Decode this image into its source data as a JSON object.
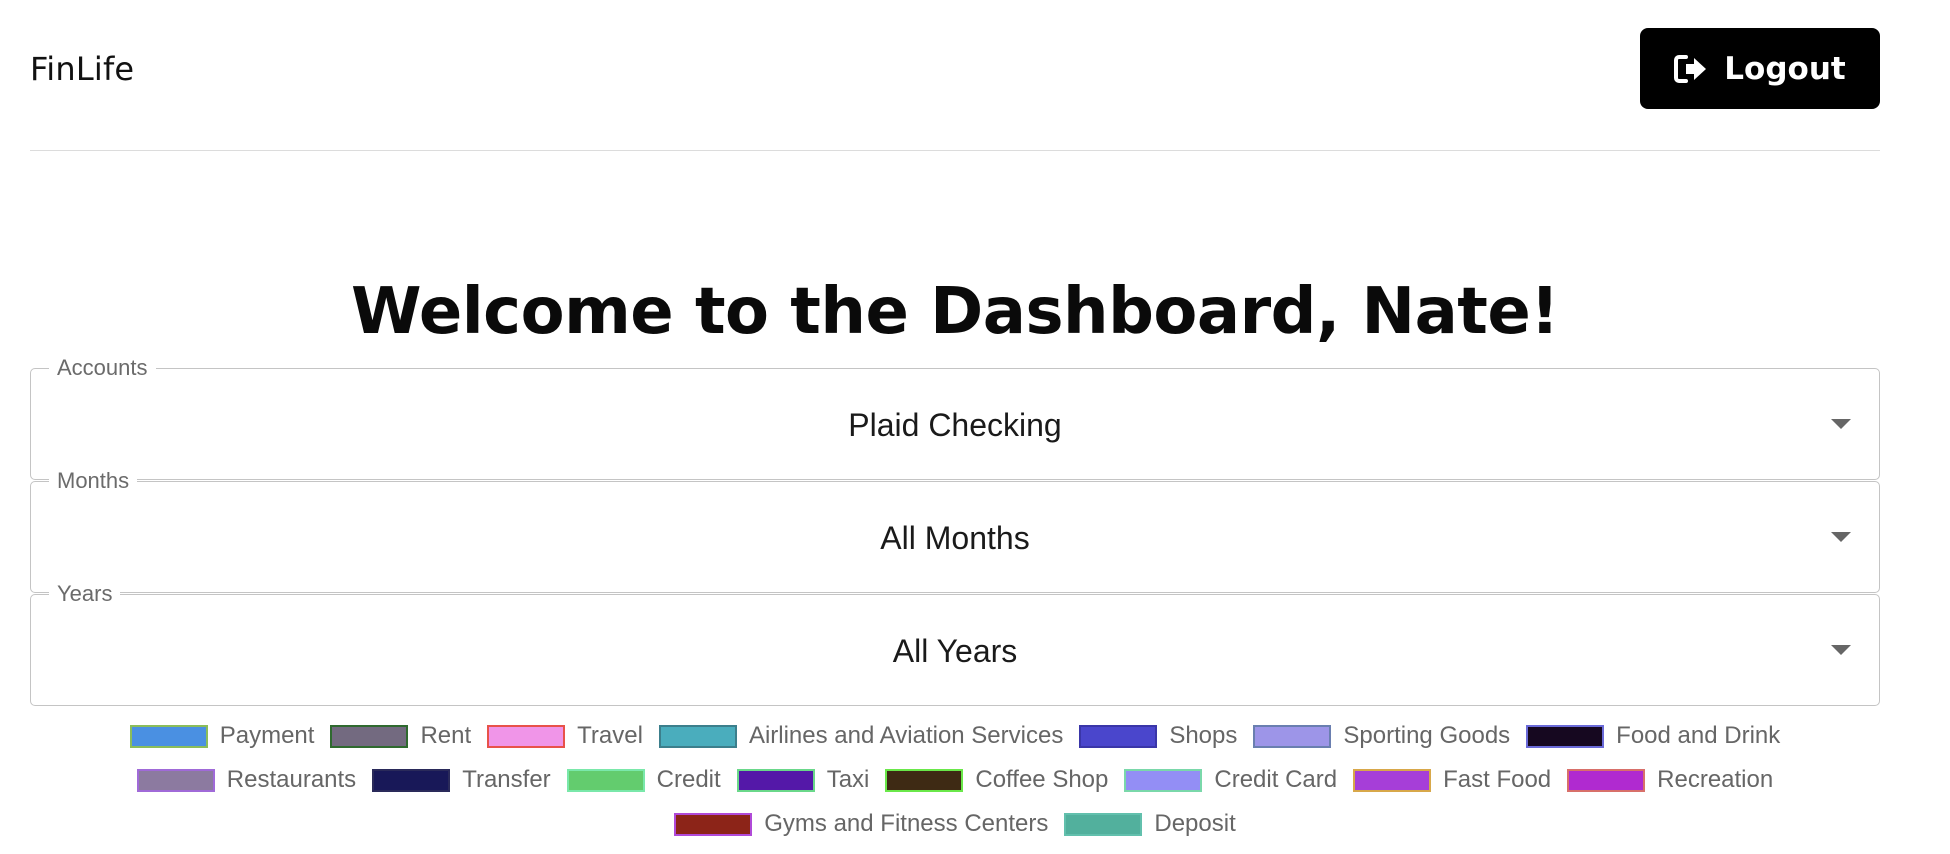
{
  "header": {
    "brand": "FinLife",
    "logout_label": "Logout",
    "logout_icon": "sign-out-icon"
  },
  "title": "Welcome to the Dashboard, Nate!",
  "filters": {
    "accounts": {
      "label": "Accounts",
      "value": "Plaid Checking"
    },
    "months": {
      "label": "Months",
      "value": "All Months"
    },
    "years": {
      "label": "Years",
      "value": "All Years"
    }
  },
  "legend": {
    "rows": [
      [
        {
          "label": "Payment",
          "fill": "#4a90e2",
          "border": "#8bbd5a"
        },
        {
          "label": "Rent",
          "fill": "#736a80",
          "border": "#2f6a2f"
        },
        {
          "label": "Travel",
          "fill": "#f095e8",
          "border": "#e8524a"
        },
        {
          "label": "Airlines and Aviation Services",
          "fill": "#4aadbd",
          "border": "#3c7f8c"
        },
        {
          "label": "Shops",
          "fill": "#4a46cc",
          "border": "#3a36a8"
        },
        {
          "label": "Sporting Goods",
          "fill": "#9d95e8",
          "border": "#6a7fb0"
        },
        {
          "label": "Food and Drink",
          "fill": "#160820",
          "border": "#6a6ad8"
        }
      ],
      [
        {
          "label": "Restaurants",
          "fill": "#8c7aa0",
          "border": "#a06ad8"
        },
        {
          "label": "Transfer",
          "fill": "#181858",
          "border": "#2a2a5a"
        },
        {
          "label": "Credit",
          "fill": "#63cc6e",
          "border": "#7ae8aa"
        },
        {
          "label": "Taxi",
          "fill": "#5418a8",
          "border": "#6ad88a"
        },
        {
          "label": "Coffee Shop",
          "fill": "#3e2a14",
          "border": "#6ae84a"
        },
        {
          "label": "Credit Card",
          "fill": "#938ef5",
          "border": "#7ad8aa"
        },
        {
          "label": "Fast Food",
          "fill": "#a63ed8",
          "border": "#d8a84a"
        },
        {
          "label": "Recreation",
          "fill": "#b02ad0",
          "border": "#d8706a"
        }
      ],
      [
        {
          "label": "Gyms and Fitness Centers",
          "fill": "#8c2418",
          "border": "#b04ad8"
        },
        {
          "label": "Deposit",
          "fill": "#52b09d",
          "border": "#62c0ad"
        }
      ]
    ]
  }
}
